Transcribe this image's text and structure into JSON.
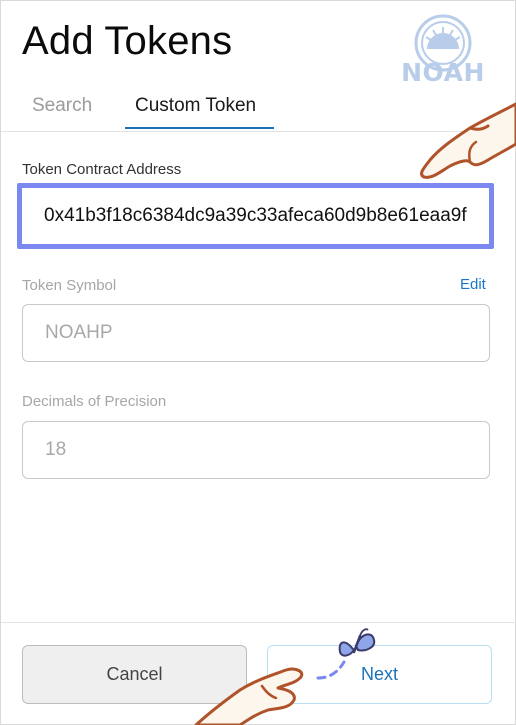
{
  "header": {
    "title": "Add Tokens",
    "logo_text": "NOAH"
  },
  "tabs": [
    {
      "label": "Search",
      "active": false
    },
    {
      "label": "Custom Token",
      "active": true
    }
  ],
  "form": {
    "contract_address": {
      "label": "Token Contract Address",
      "value": "0x41b3f18c6384dc9a39c33afeca60d9b8e61eaa9f"
    },
    "token_symbol": {
      "label": "Token Symbol",
      "edit_label": "Edit",
      "value": "NOAHP"
    },
    "decimals": {
      "label": "Decimals of Precision",
      "value": "18"
    }
  },
  "footer": {
    "cancel_label": "Cancel",
    "next_label": "Next"
  },
  "colors": {
    "accent": "#1b73b7",
    "focus_border": "#7b88ef",
    "logo": "#b7cdea",
    "hand_outline": "#b0532a",
    "hand_fill": "#fdf6ec"
  }
}
